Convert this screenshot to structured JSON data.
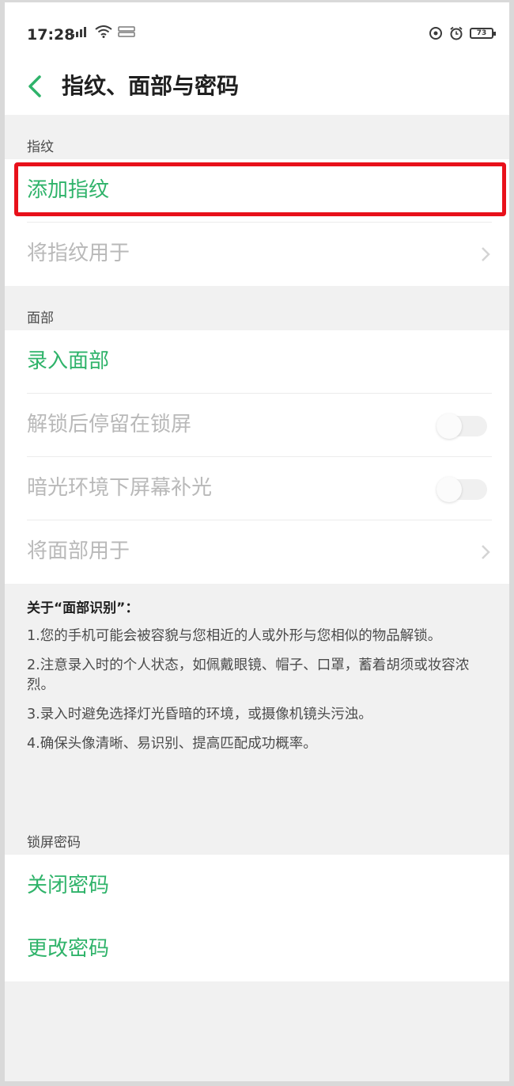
{
  "status_bar": {
    "time": "17:28",
    "battery": "73"
  },
  "header": {
    "title": "指纹、面部与密码"
  },
  "fingerprint": {
    "section_label": "指纹",
    "add": "添加指纹",
    "use_for": "将指纹用于"
  },
  "face": {
    "section_label": "面部",
    "enroll": "录入面部",
    "stay_on_lockscreen": "解锁后停留在锁屏",
    "dim_fill_light": "暗光环境下屏幕补光",
    "use_for": "将面部用于"
  },
  "toggles": {
    "stay_on_lockscreen": false,
    "dim_fill_light": false
  },
  "info": {
    "title": "关于“面部识别”：",
    "items": [
      "1.您的手机可能会被容貌与您相近的人或外形与您相似的物品解锁。",
      "2.注意录入时的个人状态，如佩戴眼镜、帽子、口罩，蓄着胡须或妆容浓烈。",
      "3.录入时避免选择灯光昏暗的环境，或摄像机镜头污浊。",
      "4.确保头像清晰、易识别、提高匹配成功概率。"
    ]
  },
  "lock_password": {
    "section_label": "锁屏密码",
    "disable": "关闭密码",
    "change": "更改密码"
  },
  "colors": {
    "accent_green": "#2fb36a",
    "highlight_red": "#e8101a"
  }
}
